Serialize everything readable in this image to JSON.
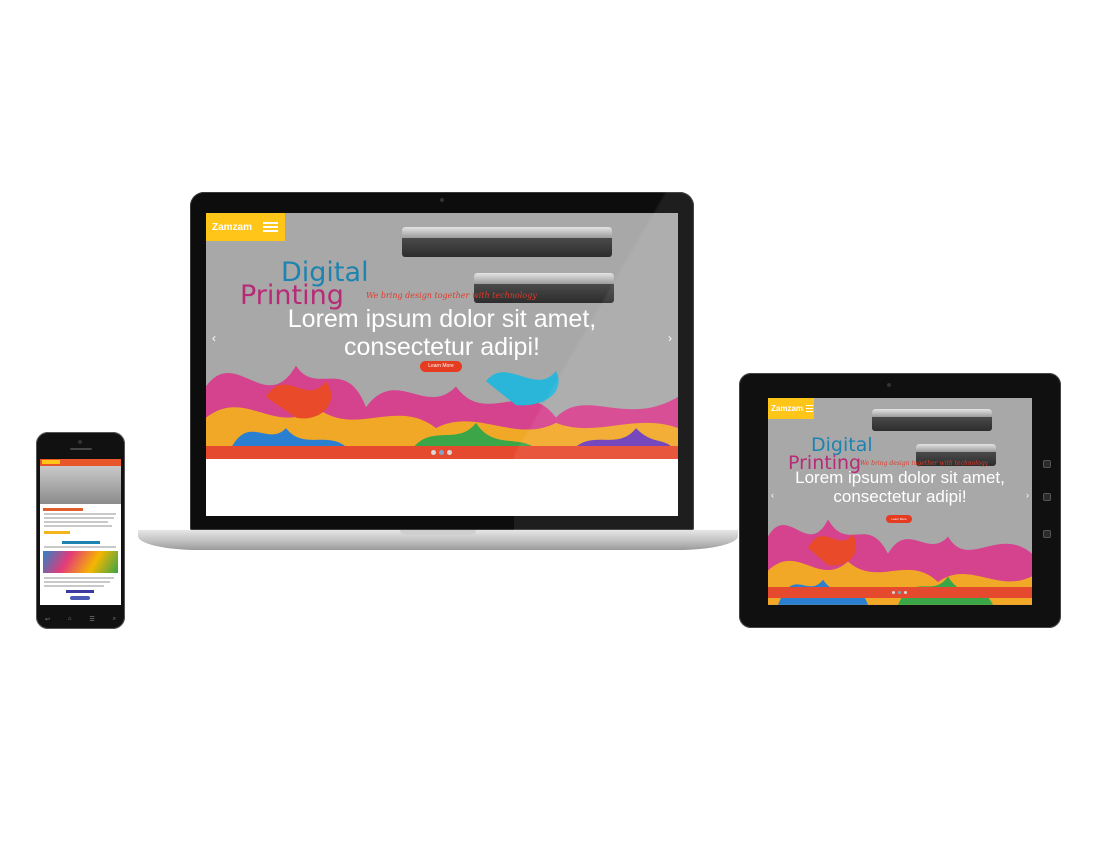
{
  "site": {
    "brand": "Zamzam",
    "hero_title_line1": "Digital",
    "hero_title_line2": "Printing",
    "hero_tagline": "We bring design together with technology",
    "headline": "Lorem ipsum dolor sit amet, consectetur adipi!",
    "cta_label": "Learn More",
    "prev_arrow": "‹",
    "next_arrow": "›",
    "slide_count": 3,
    "active_slide": 2
  },
  "colors": {
    "brand_yellow": "#ffc518",
    "accent_orange": "#e64a2e",
    "hero_gray": "#a9a8a8",
    "digital_blue": "#1d83b0",
    "printing_magenta": "#b72a76"
  },
  "devices": [
    "laptop",
    "tablet",
    "phone"
  ],
  "icons": [
    "hamburger-menu-icon",
    "carousel-prev-icon",
    "carousel-next-icon",
    "printer-image"
  ]
}
